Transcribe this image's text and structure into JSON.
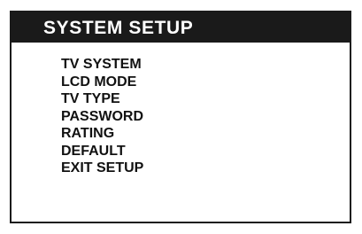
{
  "header": {
    "title": "SYSTEM SETUP"
  },
  "menu": {
    "items": [
      {
        "label": "TV SYSTEM"
      },
      {
        "label": "LCD MODE"
      },
      {
        "label": "TV TYPE"
      },
      {
        "label": "PASSWORD"
      },
      {
        "label": "RATING"
      },
      {
        "label": "DEFAULT"
      },
      {
        "label": "EXIT SETUP"
      }
    ]
  },
  "colors": {
    "header_background": "#1a1a1a",
    "header_text": "#ffffff",
    "text": "#111111",
    "border": "#1a1a1a"
  }
}
